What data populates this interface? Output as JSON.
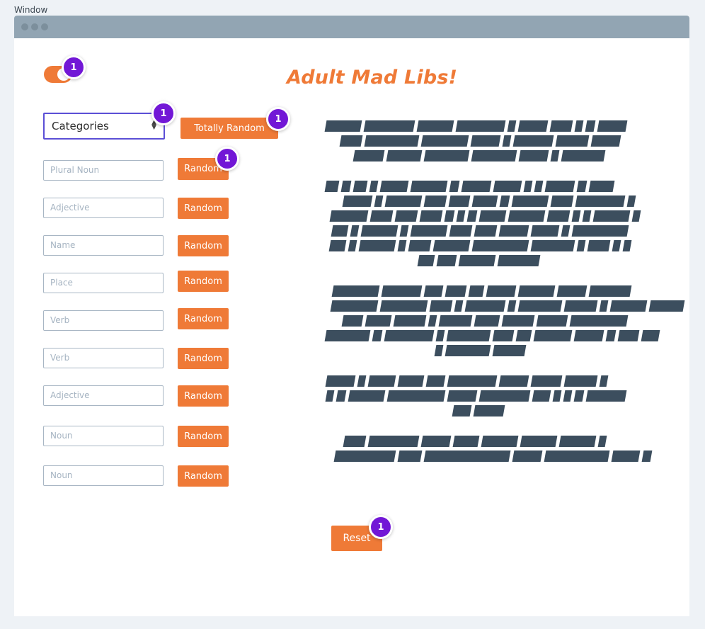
{
  "window": {
    "label": "Window"
  },
  "header": {
    "title": "Adult Mad Libs!"
  },
  "controls": {
    "categories_label": "Categories",
    "totally_random_label": "Totally Random",
    "reset_label": "Reset",
    "toggle_on": true
  },
  "fields": [
    {
      "placeholder": "Plural Noun",
      "button": "Random"
    },
    {
      "placeholder": "Adjective",
      "button": "Random"
    },
    {
      "placeholder": "Name",
      "button": "Random"
    },
    {
      "placeholder": "Place",
      "button": "Random"
    },
    {
      "placeholder": "Verb",
      "button": "Random"
    },
    {
      "placeholder": "Verb",
      "button": "Random"
    },
    {
      "placeholder": "Adjective",
      "button": "Random"
    },
    {
      "placeholder": "Noun",
      "button": "Random"
    },
    {
      "placeholder": "Noun",
      "button": "Random"
    }
  ],
  "badges": {
    "count": "1"
  },
  "colors": {
    "accent": "#ef7a37",
    "badge": "#7217d6",
    "redacted": "#3c4e5e",
    "select_border": "#5b4fd6"
  }
}
